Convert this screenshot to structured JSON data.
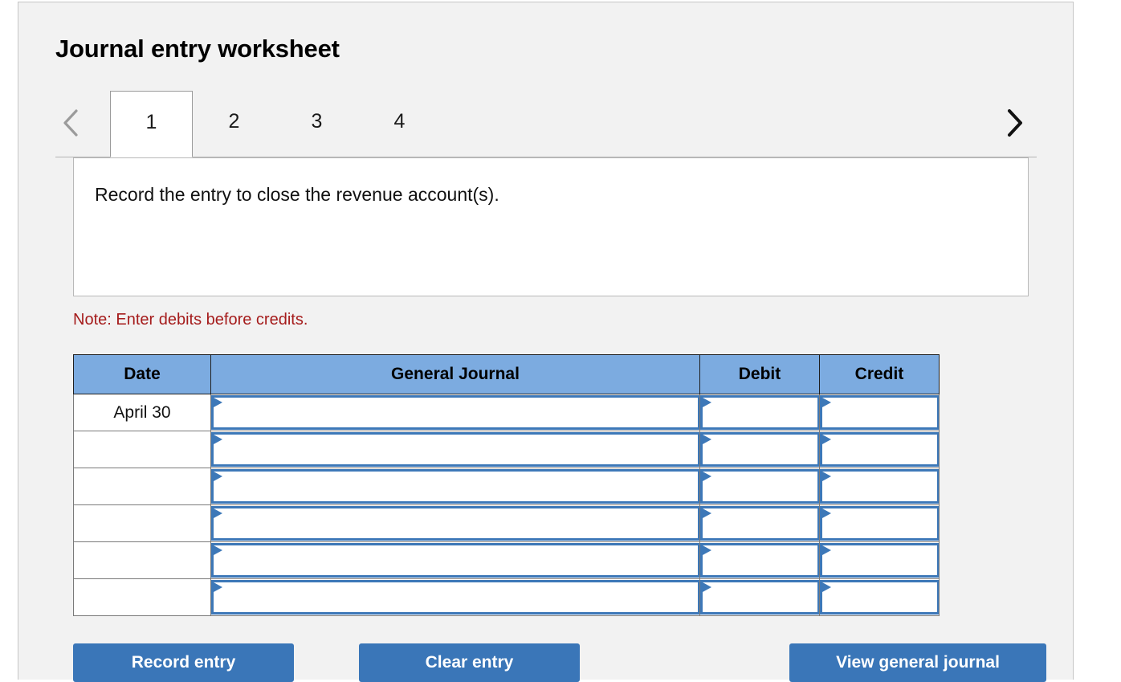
{
  "worksheet": {
    "title": "Journal entry worksheet",
    "instruction": "Record the entry to close the revenue account(s).",
    "note": "Note: Enter debits before credits."
  },
  "tabs": {
    "prev_icon": "chevron-left-icon",
    "next_icon": "chevron-right-icon",
    "items": [
      {
        "label": "1",
        "active": true
      },
      {
        "label": "2",
        "active": false
      },
      {
        "label": "3",
        "active": false
      },
      {
        "label": "4",
        "active": false
      }
    ]
  },
  "journal_table": {
    "columns": [
      "Date",
      "General Journal",
      "Debit",
      "Credit"
    ],
    "rows": [
      {
        "date": "April 30",
        "general_journal": "",
        "debit": "",
        "credit": ""
      },
      {
        "date": "",
        "general_journal": "",
        "debit": "",
        "credit": ""
      },
      {
        "date": "",
        "general_journal": "",
        "debit": "",
        "credit": ""
      },
      {
        "date": "",
        "general_journal": "",
        "debit": "",
        "credit": ""
      },
      {
        "date": "",
        "general_journal": "",
        "debit": "",
        "credit": ""
      },
      {
        "date": "",
        "general_journal": "",
        "debit": "",
        "credit": ""
      }
    ]
  },
  "buttons": {
    "record": "Record entry",
    "clear": "Clear entry",
    "view": "View general journal"
  },
  "colors": {
    "header_blue": "#7cabe0",
    "button_blue": "#3a76b8",
    "field_border_blue": "#3d78b8",
    "note_red": "#a51c1c",
    "panel_bg": "#f2f2f2"
  }
}
